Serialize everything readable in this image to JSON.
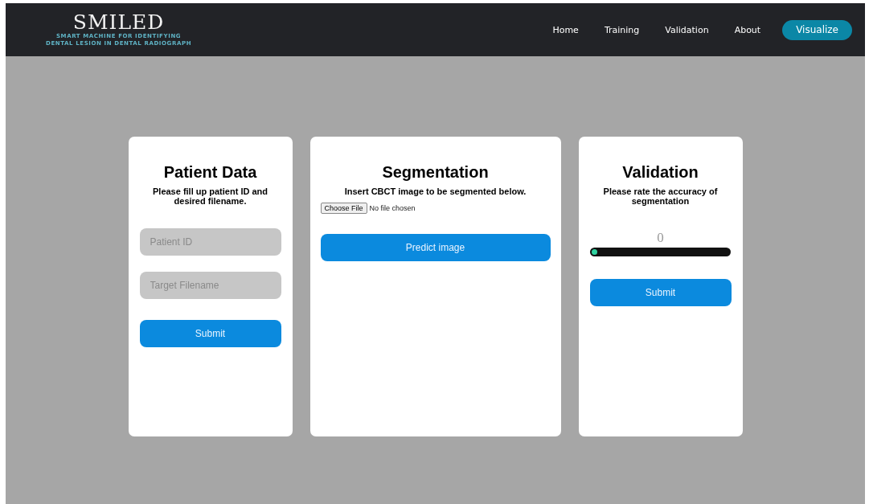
{
  "brand": {
    "title": "SMILED",
    "subtitle_lines": [
      "SMART MACHINE FOR IDENTIFYING",
      "DENTAL LESION IN DENTAL RADIOGRAPH"
    ]
  },
  "nav": {
    "links": [
      "Home",
      "Training",
      "Validation",
      "About"
    ],
    "cta": "Visualize"
  },
  "patient_card": {
    "title": "Patient Data",
    "description": "Please fill up patient ID and desired filename.",
    "fields": [
      {
        "placeholder": "Patient ID"
      },
      {
        "placeholder": "Target Filename"
      }
    ],
    "button": "Submit"
  },
  "segmentation_card": {
    "title": "Segmentation",
    "description": "Insert CBCT image to be segmented below.",
    "file_button": "Choose File",
    "file_status": "No file chosen",
    "button": "Predict image"
  },
  "validation_card": {
    "title": "Validation",
    "description": "Please rate the accuracy of segmentation",
    "reading": "0",
    "slider": {
      "level": 0
    },
    "button": "Submit"
  }
}
